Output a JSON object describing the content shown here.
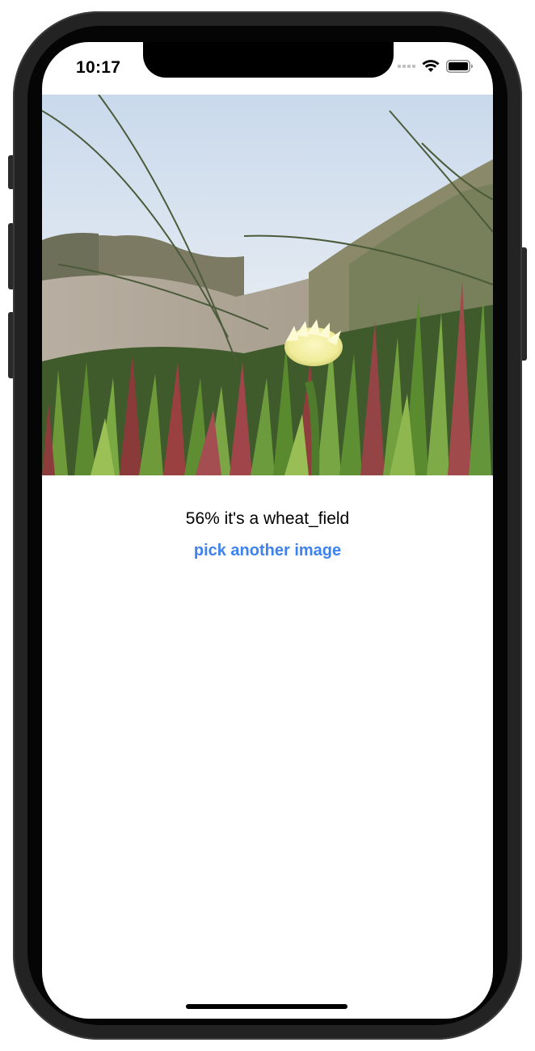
{
  "status_bar": {
    "time": "10:17"
  },
  "photo": {
    "subject": "succulent-flower-photo"
  },
  "classification": {
    "result_text": "56% it's a wheat_field"
  },
  "actions": {
    "pick_label": "pick another image"
  },
  "colors": {
    "accent": "#3d82ee",
    "frame": "#232323"
  }
}
